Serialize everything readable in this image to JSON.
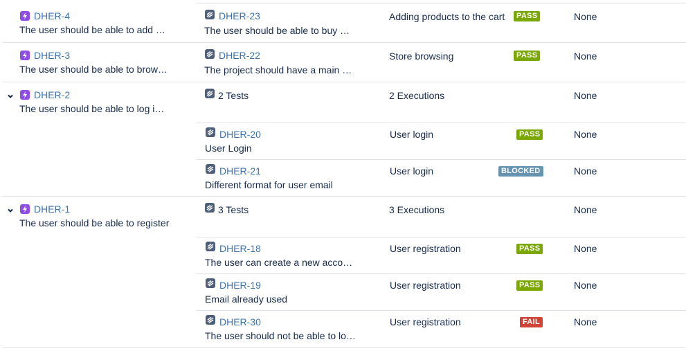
{
  "colors": {
    "pass": "#7aa800",
    "blocked": "#6693b0",
    "fail": "#d04437",
    "link": "#3b73af"
  },
  "rows": [
    {
      "req_key": "DHER-4",
      "req_summary": "The user should be able to add …",
      "test_key": "DHER-23",
      "test_summary": "The user should be able to buy …",
      "test_plan": "Adding products to the cart",
      "status": "PASS",
      "defects": "None"
    },
    {
      "req_key": "DHER-3",
      "req_summary": "The user should be able to brow…",
      "test_key": "DHER-22",
      "test_summary": "The project should have a main …",
      "test_plan": "Store browsing",
      "status": "PASS",
      "defects": "None"
    },
    {
      "req_key": "DHER-2",
      "req_summary": "The user should be able to log i…",
      "tests_count": "2 Tests",
      "executions": "2 Executions",
      "defects": "None",
      "children": [
        {
          "test_key": "DHER-20",
          "test_summary": "User Login",
          "test_plan": "User login",
          "status": "PASS",
          "defects": "None"
        },
        {
          "test_key": "DHER-21",
          "test_summary": "Different format for user email",
          "test_plan": "User login",
          "status": "BLOCKED",
          "defects": "None"
        }
      ]
    },
    {
      "req_key": "DHER-1",
      "req_summary": "The user should be able to register",
      "tests_count": "3 Tests",
      "executions": "3 Executions",
      "defects": "None",
      "children": [
        {
          "test_key": "DHER-18",
          "test_summary": "The user can create a new acco…",
          "test_plan": "User registration",
          "status": "PASS",
          "defects": "None"
        },
        {
          "test_key": "DHER-19",
          "test_summary": "Email already used",
          "test_plan": "User registration",
          "status": "PASS",
          "defects": "None"
        },
        {
          "test_key": "DHER-30",
          "test_summary": "The user should not be able to lo…",
          "test_plan": "User registration",
          "status": "FAIL",
          "defects": "None"
        }
      ]
    }
  ]
}
